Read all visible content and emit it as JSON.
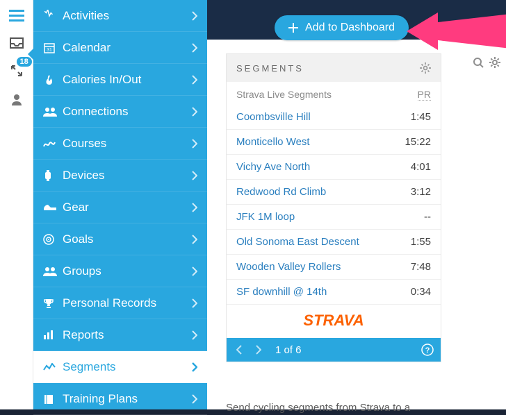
{
  "rail": {
    "badge_count": "18"
  },
  "sidebar": {
    "items": [
      {
        "label": "Activities",
        "icon": "activities-icon"
      },
      {
        "label": "Calendar",
        "icon": "calendar-icon"
      },
      {
        "label": "Calories In/Out",
        "icon": "calories-icon"
      },
      {
        "label": "Connections",
        "icon": "connections-icon"
      },
      {
        "label": "Courses",
        "icon": "courses-icon"
      },
      {
        "label": "Devices",
        "icon": "devices-icon"
      },
      {
        "label": "Gear",
        "icon": "gear-icon"
      },
      {
        "label": "Goals",
        "icon": "goals-icon"
      },
      {
        "label": "Groups",
        "icon": "groups-icon"
      },
      {
        "label": "Personal Records",
        "icon": "personal-records-icon"
      },
      {
        "label": "Reports",
        "icon": "reports-icon"
      },
      {
        "label": "Segments",
        "icon": "segments-icon"
      },
      {
        "label": "Training Plans",
        "icon": "training-plans-icon"
      }
    ]
  },
  "add_button": {
    "label": "Add to Dashboard"
  },
  "widget": {
    "title": "SEGMENTS",
    "subhead_left": "Strava Live Segments",
    "subhead_right": "PR",
    "segments": [
      {
        "name": "Coombsville Hill",
        "time": "1:45"
      },
      {
        "name": "Monticello West",
        "time": "15:22"
      },
      {
        "name": "Vichy Ave North",
        "time": "4:01"
      },
      {
        "name": "Redwood Rd Climb",
        "time": "3:12"
      },
      {
        "name": "JFK 1M loop",
        "time": "--"
      },
      {
        "name": "Old Sonoma East Descent",
        "time": "1:55"
      },
      {
        "name": "Wooden Valley Rollers",
        "time": "7:48"
      },
      {
        "name": "SF downhill @ 14th",
        "time": "0:34"
      }
    ],
    "brand": "STRAVA",
    "pager": "1 of 6"
  },
  "below_text": "Send cycling segments from Strava to a"
}
